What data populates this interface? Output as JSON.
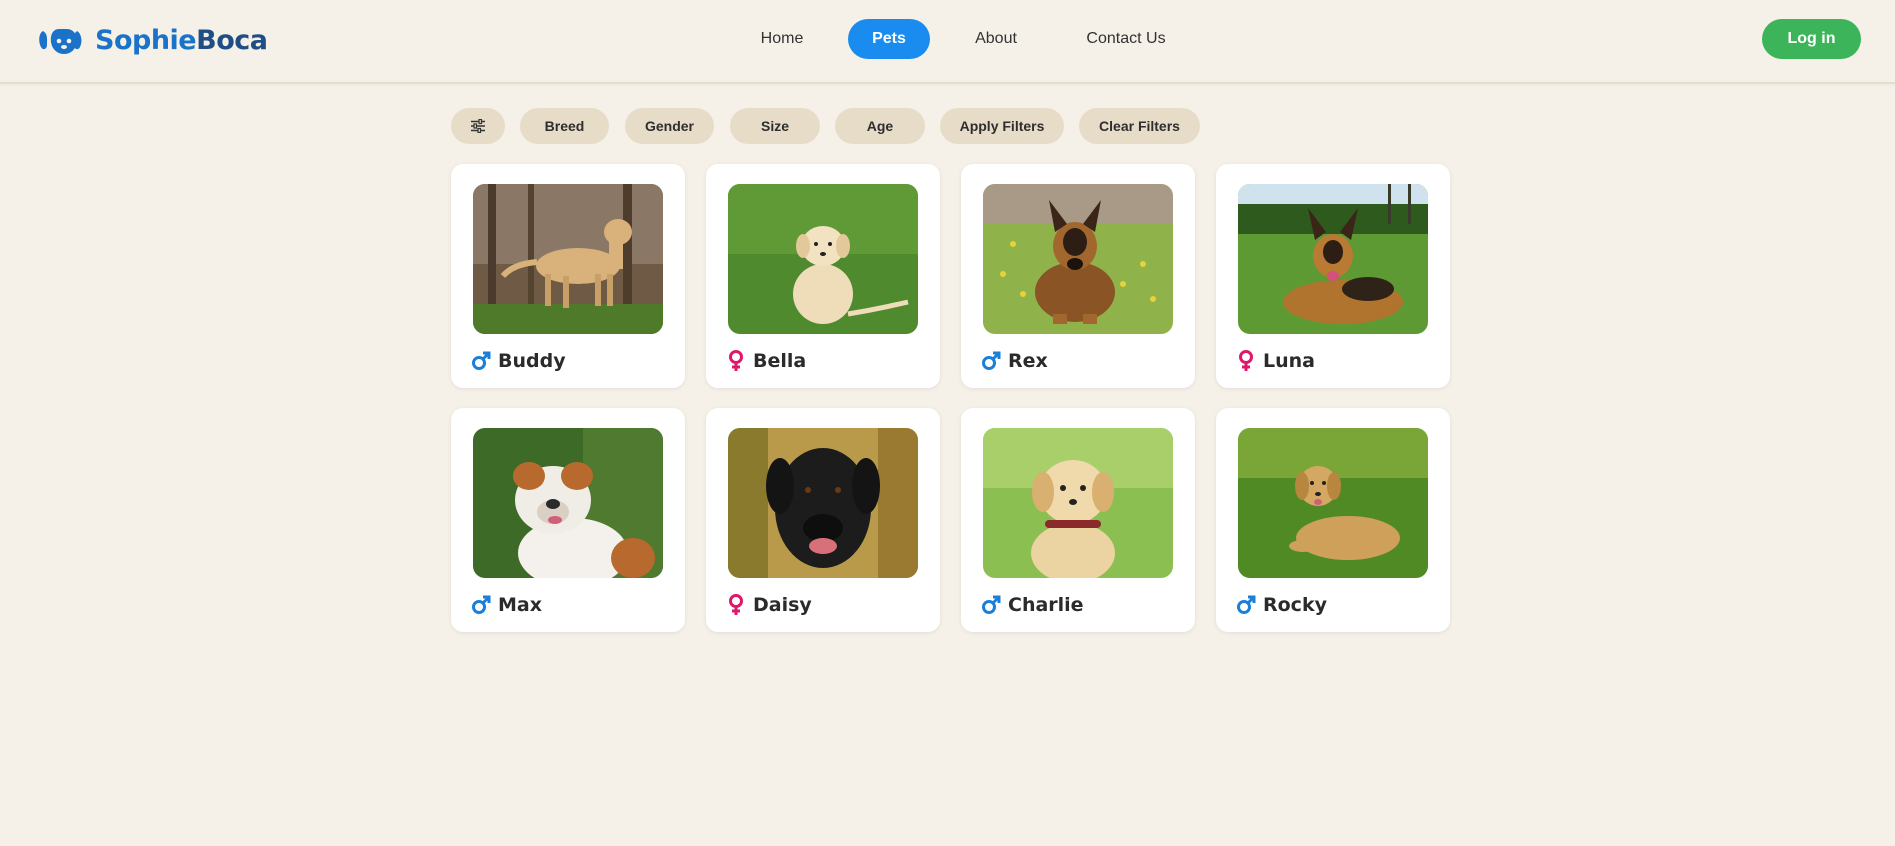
{
  "brand": {
    "name_part1": "Sophie",
    "name_part2": "Boca"
  },
  "nav": {
    "home": "Home",
    "pets": "Pets",
    "about": "About",
    "contact": "Contact Us"
  },
  "header": {
    "login_label": "Log in"
  },
  "filters": {
    "breed": "Breed",
    "gender": "Gender",
    "size": "Size",
    "age": "Age",
    "apply": "Apply Filters",
    "clear": "Clear Filters"
  },
  "colors": {
    "accent": "#1a8cef",
    "login": "#3cb55a",
    "male": "#1a7fd9",
    "female": "#e0186c",
    "background": "#f5f0e8",
    "chip": "#e6dcc8"
  },
  "pets": [
    {
      "name": "Buddy",
      "gender": "male",
      "icon": "male-icon"
    },
    {
      "name": "Bella",
      "gender": "female",
      "icon": "female-icon"
    },
    {
      "name": "Rex",
      "gender": "male",
      "icon": "male-icon"
    },
    {
      "name": "Luna",
      "gender": "female",
      "icon": "female-icon"
    },
    {
      "name": "Max",
      "gender": "male",
      "icon": "male-icon"
    },
    {
      "name": "Daisy",
      "gender": "female",
      "icon": "female-icon"
    },
    {
      "name": "Charlie",
      "gender": "male",
      "icon": "male-icon"
    },
    {
      "name": "Rocky",
      "gender": "male",
      "icon": "male-icon"
    }
  ]
}
